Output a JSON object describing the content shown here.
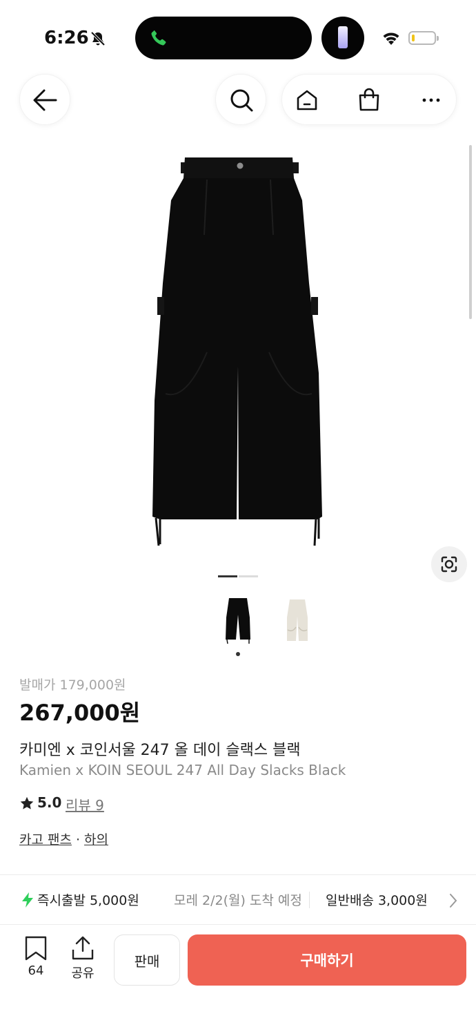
{
  "status_bar": {
    "time": "6:26",
    "icons": [
      "bell-slash-icon",
      "phone-icon",
      "flashlight-icon",
      "wifi-icon",
      "battery-icon"
    ],
    "battery_level": 0.1,
    "colors": {
      "call": "#34c759",
      "battery_low": "#f0c419"
    }
  },
  "nav": {
    "icons": [
      "back-arrow-icon",
      "search-icon",
      "home-icon",
      "shopping-bag-icon",
      "more-icon"
    ]
  },
  "gallery": {
    "image_count": 2,
    "current_index": 1,
    "thumbnails": [
      {
        "color": "black",
        "selected": true
      },
      {
        "color": "beige",
        "selected": false
      }
    ]
  },
  "product": {
    "release_price": "발매가 179,000원",
    "price": "267,000원",
    "name_ko": "카미엔 x 코인서울 247 올 데이 슬랙스 블랙",
    "name_en": "Kamien x KOIN SEOUL 247 All Day Slacks Black",
    "rating": "5.0",
    "review_link": "리뷰 9",
    "categories": [
      "카고 팬츠",
      "하의"
    ],
    "category_separator": "·"
  },
  "shipping": {
    "express": "즉시출발 5,000원",
    "eta": "모레 2/2(월) 도착 예정",
    "normal": "일반배송 3,000원",
    "accent": "#2fcf5b"
  },
  "bottom_bar": {
    "bookmark_count": "64",
    "share_label": "공유",
    "sell_label": "판매",
    "buy_label": "구매하기",
    "buy_color": "#ef6253"
  }
}
